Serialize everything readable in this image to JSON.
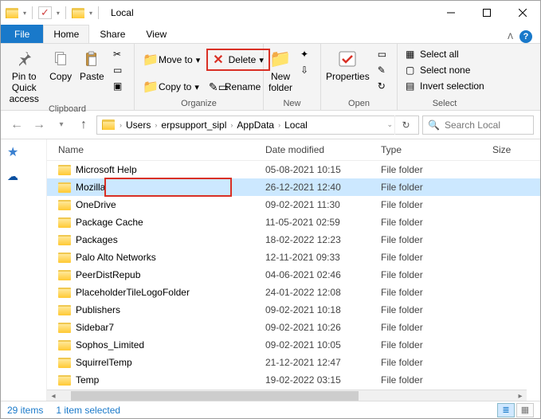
{
  "window": {
    "title": "Local"
  },
  "tabs": {
    "file": "File",
    "home": "Home",
    "share": "Share",
    "view": "View"
  },
  "ribbon": {
    "clipboard": {
      "label": "Clipboard",
      "pin": "Pin to Quick access",
      "copy": "Copy",
      "paste": "Paste"
    },
    "organize": {
      "label": "Organize",
      "moveto": "Move to",
      "copyto": "Copy to",
      "delete": "Delete",
      "rename": "Rename"
    },
    "new": {
      "label": "New",
      "newfolder": "New folder"
    },
    "open": {
      "label": "Open",
      "properties": "Properties"
    },
    "select": {
      "label": "Select",
      "all": "Select all",
      "none": "Select none",
      "invert": "Invert selection"
    }
  },
  "breadcrumb": {
    "c1": "Users",
    "c2": "erpsupport_sipl",
    "c3": "AppData",
    "c4": "Local"
  },
  "search": {
    "placeholder": "Search Local"
  },
  "columns": {
    "name": "Name",
    "date": "Date modified",
    "type": "Type",
    "size": "Size"
  },
  "rows": [
    {
      "name": "Microsoft Help",
      "date": "05-08-2021 10:15",
      "type": "File folder",
      "size": ""
    },
    {
      "name": "Mozilla",
      "date": "26-12-2021 12:40",
      "type": "File folder",
      "size": ""
    },
    {
      "name": "OneDrive",
      "date": "09-02-2021 11:30",
      "type": "File folder",
      "size": ""
    },
    {
      "name": "Package Cache",
      "date": "11-05-2021 02:59",
      "type": "File folder",
      "size": ""
    },
    {
      "name": "Packages",
      "date": "18-02-2022 12:23",
      "type": "File folder",
      "size": ""
    },
    {
      "name": "Palo Alto Networks",
      "date": "12-11-2021 09:33",
      "type": "File folder",
      "size": ""
    },
    {
      "name": "PeerDistRepub",
      "date": "04-06-2021 02:46",
      "type": "File folder",
      "size": ""
    },
    {
      "name": "PlaceholderTileLogoFolder",
      "date": "24-01-2022 12:08",
      "type": "File folder",
      "size": ""
    },
    {
      "name": "Publishers",
      "date": "09-02-2021 10:18",
      "type": "File folder",
      "size": ""
    },
    {
      "name": "Sidebar7",
      "date": "09-02-2021 10:26",
      "type": "File folder",
      "size": ""
    },
    {
      "name": "Sophos_Limited",
      "date": "09-02-2021 10:05",
      "type": "File folder",
      "size": ""
    },
    {
      "name": "SquirrelTemp",
      "date": "21-12-2021 12:47",
      "type": "File folder",
      "size": ""
    },
    {
      "name": "Temp",
      "date": "19-02-2022 03:15",
      "type": "File folder",
      "size": ""
    }
  ],
  "status": {
    "count": "29 items",
    "selected": "1 item selected"
  }
}
